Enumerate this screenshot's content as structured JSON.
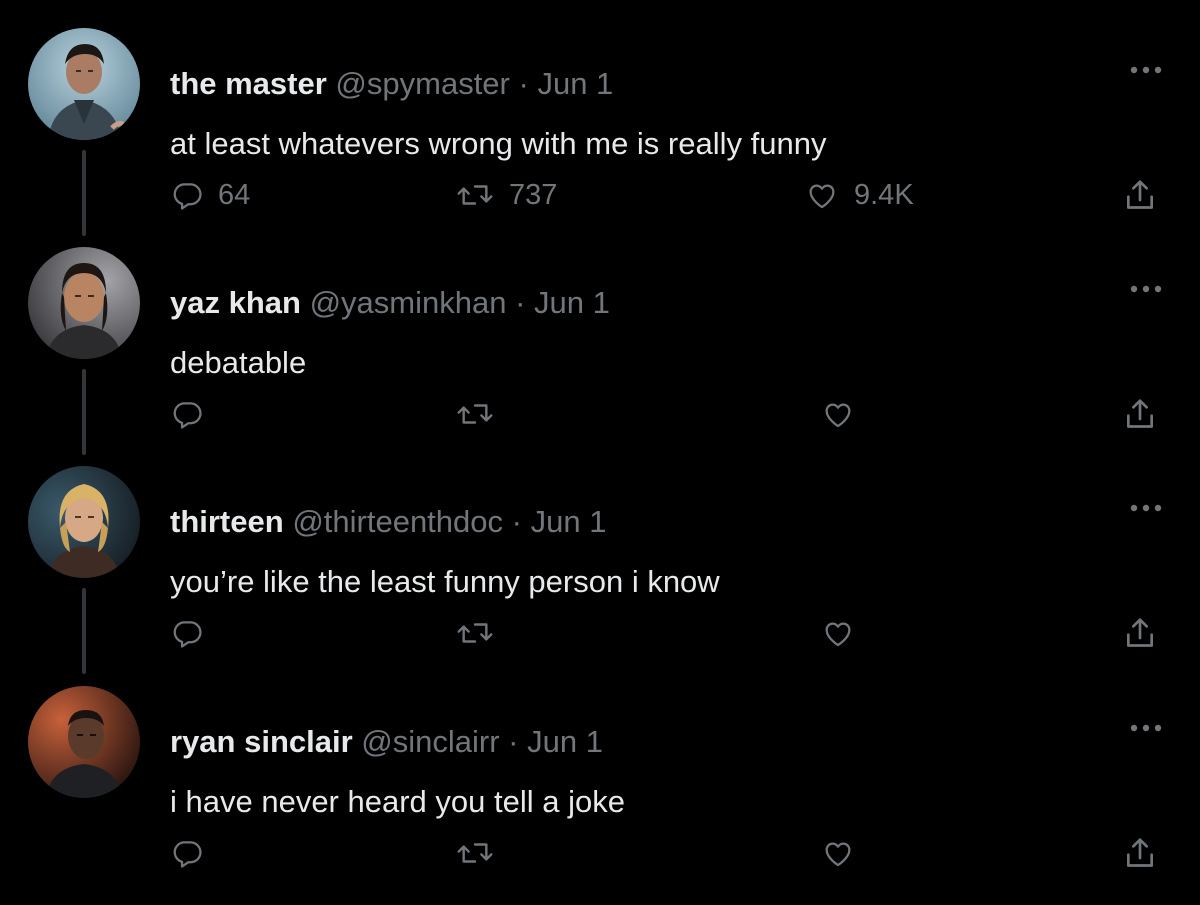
{
  "colors": {
    "background": "#000000",
    "primary_text": "#e7e9ea",
    "secondary_text": "#71767b",
    "thread_line": "#333639"
  },
  "tweets": [
    {
      "name": "the master",
      "handle": "@spymaster",
      "separator": "·",
      "date": "Jun 1",
      "text": "at least whatevers wrong with me is really funny",
      "replies": "64",
      "retweets": "737",
      "likes": "9.4K",
      "avatar_icon": "avatar-the-master"
    },
    {
      "name": "yaz khan",
      "handle": "@yasminkhan",
      "separator": "·",
      "date": "Jun 1",
      "text": "debatable",
      "replies": "",
      "retweets": "",
      "likes": "",
      "avatar_icon": "avatar-yaz-khan"
    },
    {
      "name": "thirteen",
      "handle": "@thirteenthdoc",
      "separator": "·",
      "date": "Jun 1",
      "text": "you’re like the least funny person i know",
      "replies": "",
      "retweets": "",
      "likes": "",
      "avatar_icon": "avatar-thirteen"
    },
    {
      "name": "ryan sinclair",
      "handle": "@sinclairr",
      "separator": "·",
      "date": "Jun 1",
      "text": "i have never heard you tell a joke",
      "replies": "",
      "retweets": "",
      "likes": "",
      "avatar_icon": "avatar-ryan-sinclair"
    }
  ],
  "icons": {
    "reply": "reply-icon",
    "retweet": "retweet-icon",
    "like": "heart-icon",
    "share": "share-icon",
    "more": "more-icon"
  }
}
